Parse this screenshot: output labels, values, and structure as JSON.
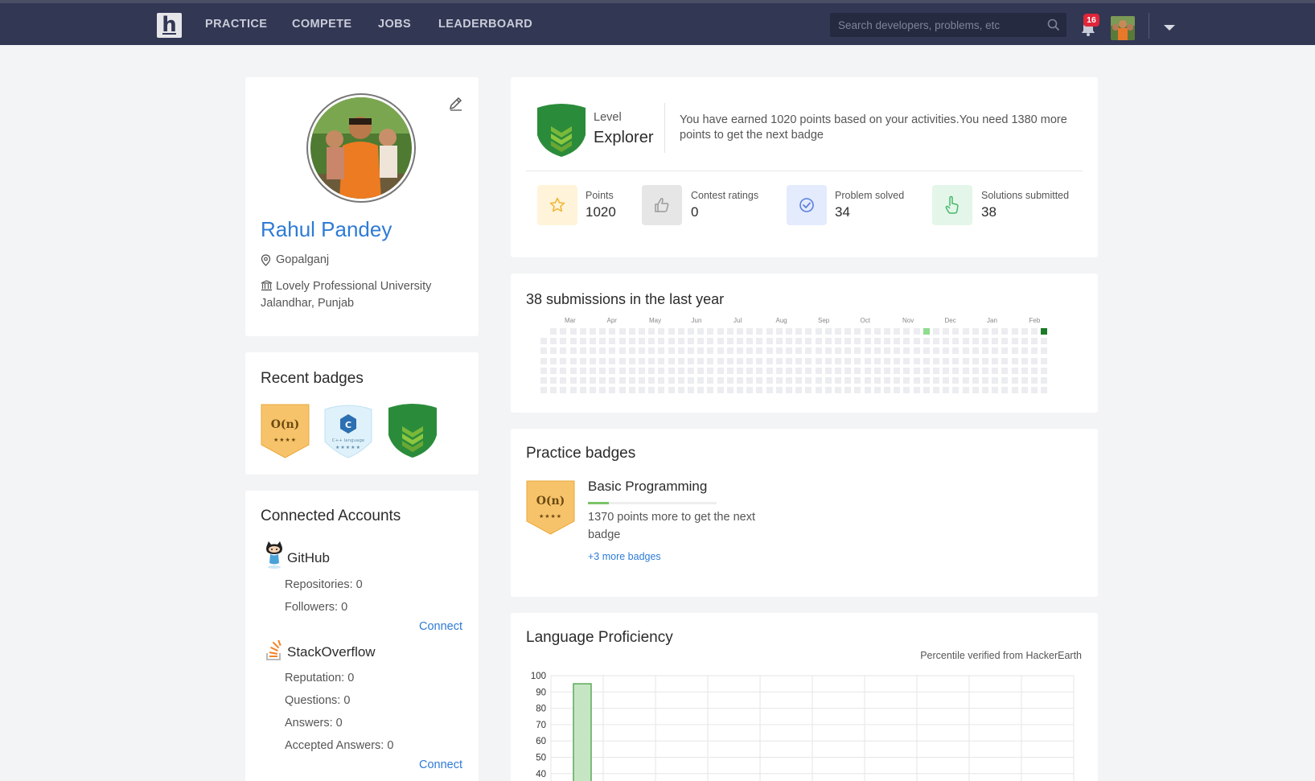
{
  "nav": {
    "logo_letter": "h",
    "links": [
      "PRACTICE",
      "COMPETE",
      "JOBS",
      "LEADERBOARD"
    ],
    "search_placeholder": "Search developers, problems, etc",
    "notification_count": "16"
  },
  "profile": {
    "name": "Rahul Pandey",
    "location": "Gopalganj",
    "university": "Lovely Professional University Jalandhar, Punjab"
  },
  "recent_badges": {
    "title": "Recent badges",
    "items": [
      {
        "label": "O(n)",
        "stars": "★★★★",
        "color": "#f7c36a"
      },
      {
        "label": "C++ language",
        "stars": "★★★★★",
        "color": "#d7eefa"
      },
      {
        "label": "Explorer",
        "color": "#2a8c3a"
      }
    ]
  },
  "connected": {
    "title": "Connected Accounts",
    "github": {
      "name": "GitHub",
      "repositories": "Repositories: 0",
      "followers": "Followers: 0",
      "connect": "Connect"
    },
    "stackoverflow": {
      "name": "StackOverflow",
      "reputation": "Reputation: 0",
      "questions": "Questions: 0",
      "answers": "Answers: 0",
      "accepted": "Accepted Answers: 0",
      "connect": "Connect"
    }
  },
  "level": {
    "label": "Level",
    "name": "Explorer",
    "message": "You have earned 1020 points based on your activities.You need 1380 more points to get the next badge"
  },
  "stats": [
    {
      "label": "Points",
      "value": "1020",
      "bg": "#fff4d9",
      "icon": "star-icon",
      "color": "#f2b233"
    },
    {
      "label": "Contest ratings",
      "value": "0",
      "bg": "#e6e6e6",
      "icon": "thumbs-up-icon",
      "color": "#9a9a9a"
    },
    {
      "label": "Problem solved",
      "value": "34",
      "bg": "#e3ebfd",
      "icon": "check-circle-icon",
      "color": "#5b7fe0"
    },
    {
      "label": "Solutions submitted",
      "value": "38",
      "bg": "#e4f6e9",
      "icon": "pointer-hand-icon",
      "color": "#45b96a"
    }
  ],
  "submissions": {
    "title": "38 submissions in the last year",
    "months": [
      "Mar",
      "Apr",
      "May",
      "Jun",
      "Jul",
      "Aug",
      "Sep",
      "Oct",
      "Nov",
      "Dec",
      "Jan",
      "Feb"
    ],
    "active_cells": [
      {
        "week": 39,
        "day": 0,
        "level": 1
      },
      {
        "week": 51,
        "day": 0,
        "level": 3
      }
    ],
    "colors": {
      "empty": "#ebedf0",
      "light": "#8fdc8f",
      "dark": "#1d7a27"
    }
  },
  "practice_badges": {
    "title": "Practice badges",
    "badge_label": "O(n)",
    "badge_stars": "★★★★",
    "name": "Basic Programming",
    "progress_fraction": 0.16,
    "message": "1370 points more to get the next badge",
    "more": "+3 more badges"
  },
  "language": {
    "title": "Language Proficiency",
    "note": "Percentile verified from HackerEarth"
  },
  "chart_data": {
    "type": "bar",
    "categories": [
      ""
    ],
    "values": [
      95
    ],
    "ylim": [
      40,
      100
    ],
    "yticks": [
      100,
      90,
      80,
      70,
      60,
      50,
      40
    ],
    "grid": true
  }
}
